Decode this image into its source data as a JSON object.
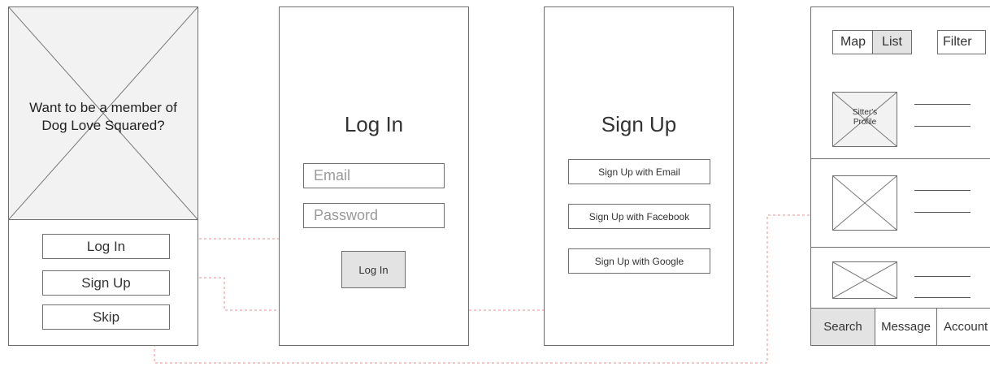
{
  "welcome": {
    "prompt_line1": "Want to be a member of",
    "prompt_line2": "Dog Love Squared?",
    "login_button": "Log In",
    "signup_button": "Sign Up",
    "skip_button": "Skip"
  },
  "login": {
    "title": "Log In",
    "email_placeholder": "Email",
    "password_placeholder": "Password",
    "submit_button": "Log In"
  },
  "signup": {
    "title": "Sign Up",
    "email_button": "Sign Up with Email",
    "facebook_button": "Sign Up with Facebook",
    "google_button": "Sign Up with Google"
  },
  "listing": {
    "map_toggle": "Map",
    "list_toggle": "List",
    "filter_button": "Filter",
    "profile_label_line1": "Sitter's",
    "profile_label_line2": "Profile",
    "tabs": [
      "Search",
      "Message",
      "Account"
    ]
  },
  "colors": {
    "connector": "#f08a8a",
    "connector_skip": "#f3a0a0",
    "placeholder_fill": "#f2f2f2",
    "selected_fill": "#e3e3e3"
  }
}
